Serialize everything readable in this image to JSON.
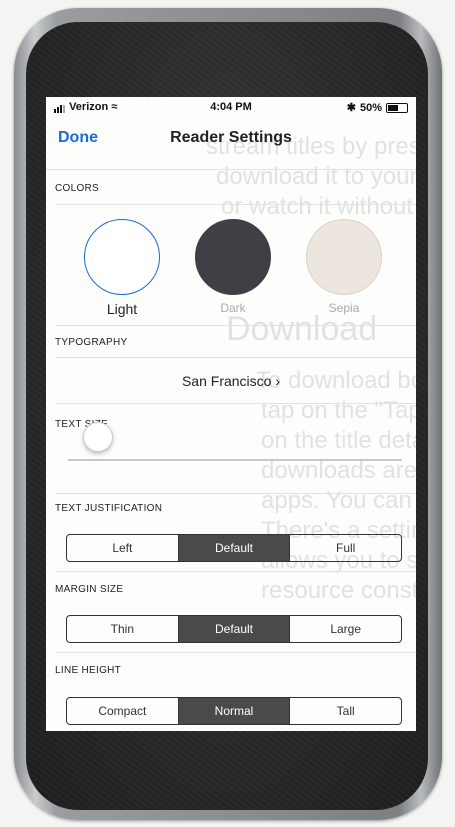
{
  "status": {
    "carrier": "Verizon",
    "time": "4:04 PM",
    "battery": "50%"
  },
  "nav": {
    "done_label": "Done",
    "title": "Reader Settings"
  },
  "background_lines": [
    "stream titles by pressing",
    "download it to your device,",
    "or watch it without Wi-Fi.",
    "Download",
    "To download borrowed content,",
    "tap on the \"Tap here to download\"",
    "on the title details page. You",
    "downloads are only available",
    "apps. You can download titles",
    "There's a setting in your app",
    "allows you to select... higher",
    "resource constraints"
  ],
  "colors": {
    "heading": "COLORS",
    "options": [
      {
        "label": "Light",
        "fill": "#ffffff",
        "ring": "#1a6bd6",
        "text_color": "#222222"
      },
      {
        "label": "Dark",
        "fill": "#3e4046",
        "ring": "#3e4046",
        "text_color": "#aaaaaa"
      },
      {
        "label": "Sepia",
        "fill": "#ede6df",
        "ring": "#d9d1ca",
        "text_color": "#aaaaaa"
      }
    ],
    "selected": "Light"
  },
  "typography": {
    "heading": "TYPOGRAPHY",
    "font": "San Francisco ›"
  },
  "text_size": {
    "heading": "TEXT SIZE",
    "level": 0.05
  },
  "justification": {
    "heading": "TEXT JUSTIFICATION",
    "options": [
      "Left",
      "Default",
      "Full"
    ],
    "selected": 1
  },
  "margin": {
    "heading": "MARGIN SIZE",
    "options": [
      "Thin",
      "Default",
      "Large"
    ],
    "selected": 1
  },
  "line_height": {
    "heading": "LINE HEIGHT",
    "options": [
      "Compact",
      "Normal",
      "Tall"
    ],
    "selected": 1
  }
}
